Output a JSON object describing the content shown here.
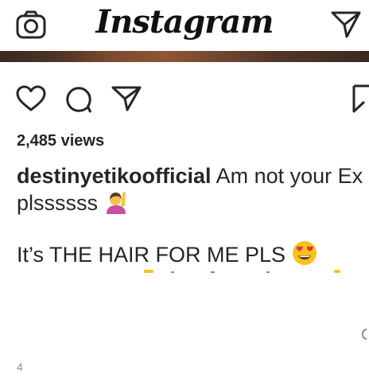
{
  "app": {
    "logo_text": "Instagram"
  },
  "header": {
    "camera_icon": "camera-icon",
    "direct_icon": "paper-plane-icon"
  },
  "actions": {
    "like_icon": "heart-icon",
    "comment_icon": "comment-icon",
    "share_icon": "paper-plane-icon",
    "save_icon": "bookmark-icon"
  },
  "post": {
    "views": "2,485 views",
    "username": "destinyetikoofficial",
    "caption_line1": " Am not your Ex plssssss",
    "caption_line2": "It’s THE HAIR FOR ME PLS",
    "timestamp": "4"
  },
  "colors": {
    "text": "#262626",
    "muted": "#8e8e8e",
    "emoji_yellow": "#f7c21b",
    "emoji_red": "#e3324a",
    "emoji_purple": "#c8509e"
  }
}
